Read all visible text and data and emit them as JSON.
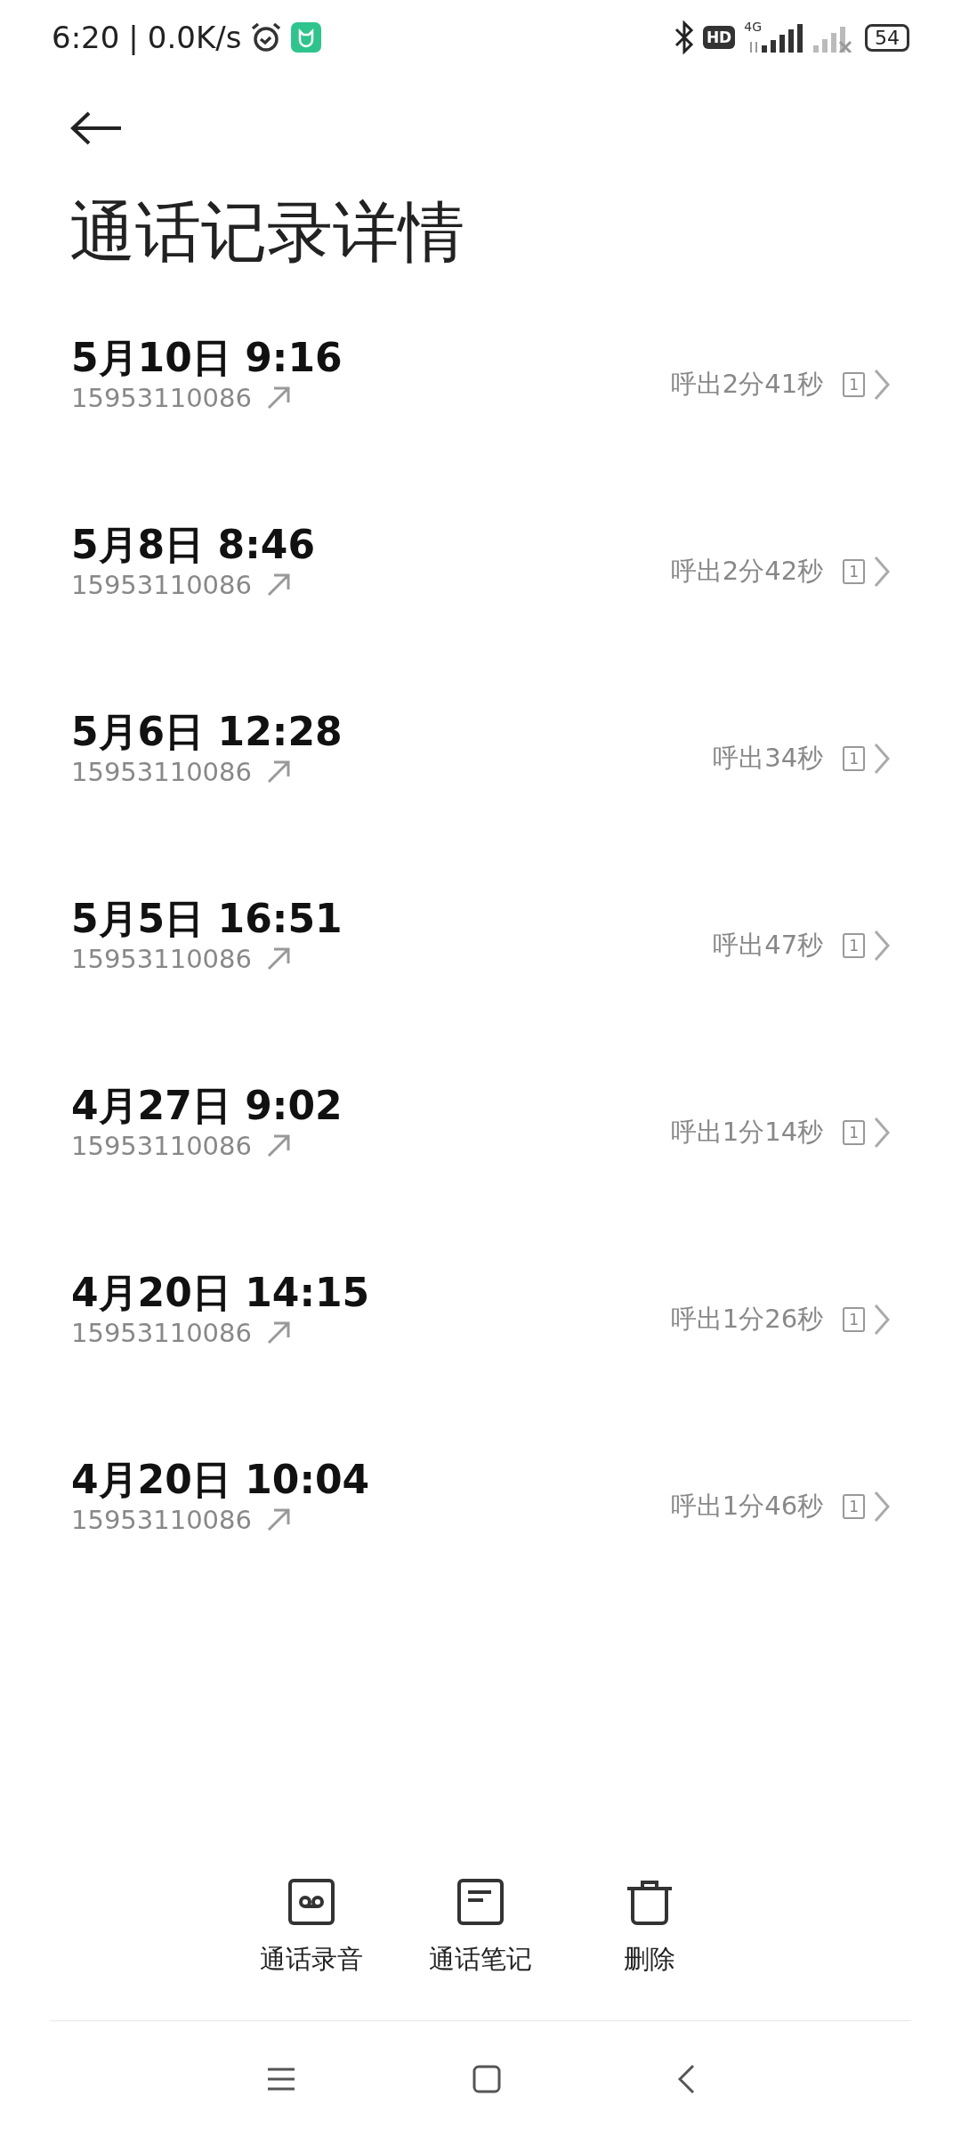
{
  "status_bar": {
    "time": "6:20",
    "separator": "|",
    "speed": "0.0K/s",
    "hd": "HD",
    "network": "4G",
    "battery": "54"
  },
  "title": "通话记录详情",
  "calls": [
    {
      "date": "5月10日 9:16",
      "number": "15953110086",
      "duration": "呼出2分41秒",
      "sim": "1"
    },
    {
      "date": "5月8日 8:46",
      "number": "15953110086",
      "duration": "呼出2分42秒",
      "sim": "1"
    },
    {
      "date": "5月6日 12:28",
      "number": "15953110086",
      "duration": "呼出34秒",
      "sim": "1"
    },
    {
      "date": "5月5日 16:51",
      "number": "15953110086",
      "duration": "呼出47秒",
      "sim": "1"
    },
    {
      "date": "4月27日 9:02",
      "number": "15953110086",
      "duration": "呼出1分14秒",
      "sim": "1"
    },
    {
      "date": "4月20日 14:15",
      "number": "15953110086",
      "duration": "呼出1分26秒",
      "sim": "1"
    },
    {
      "date": "4月20日 10:04",
      "number": "15953110086",
      "duration": "呼出1分46秒",
      "sim": "1"
    }
  ],
  "actions": [
    {
      "kind": "record",
      "label": "通话录音"
    },
    {
      "kind": "note",
      "label": "通话笔记"
    },
    {
      "kind": "delete",
      "label": "删除"
    }
  ]
}
